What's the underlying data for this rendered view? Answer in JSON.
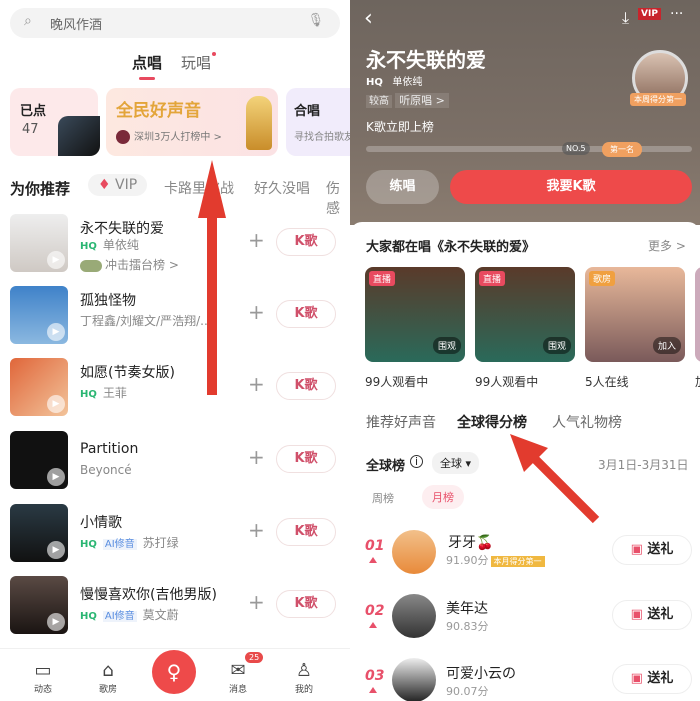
{
  "left": {
    "search": {
      "placeholder": "晚风作酒",
      "icon": "microphone-icon"
    },
    "tabs": [
      {
        "label": "点唱",
        "active": true
      },
      {
        "label": "玩唱",
        "dot": true
      }
    ],
    "cards": {
      "sung": {
        "label": "已点",
        "count": "47"
      },
      "promo": {
        "title": "全民好声音",
        "sub": "深圳3万人打榜中 >"
      },
      "chorus": {
        "title": "合唱",
        "sub": "寻找合拍歌友"
      }
    },
    "categories": [
      "为你推荐",
      "VIP",
      "卡路里挑战",
      "好久没唱",
      "伤感"
    ],
    "songs": [
      {
        "title": "永不失联的爱",
        "hq": "HQ",
        "artist": "单依纯",
        "extra": "冲击擂台榜 >"
      },
      {
        "title": "孤独怪物",
        "artist": "丁程鑫/刘耀文/严浩翔/..."
      },
      {
        "title": "如愿(节奏女版)",
        "hq": "HQ",
        "artist": "王菲"
      },
      {
        "title": "Partition",
        "artist": "Beyoncé"
      },
      {
        "title": "小情歌",
        "hq": "HQ",
        "ai": "AI修音",
        "artist": "苏打绿"
      },
      {
        "title": "慢慢喜欢你(吉他男版)",
        "hq": "HQ",
        "ai": "AI修音",
        "artist": "莫文蔚"
      }
    ],
    "k_label": "K歌",
    "nav": [
      {
        "label": "动态",
        "icon": "chat-icon"
      },
      {
        "label": "歌房",
        "icon": "house-icon"
      },
      {
        "label": "",
        "icon": "microphone-icon"
      },
      {
        "label": "消息",
        "icon": "mail-icon",
        "badge": "25"
      },
      {
        "label": "我的",
        "icon": "user-icon"
      }
    ]
  },
  "right": {
    "header": {
      "vip": "VIP",
      "title": "永不失联的爱",
      "hq": "HQ",
      "artist": "单依纯",
      "level": "较高",
      "original": "听原唱 >",
      "cta": "K歌立即上榜",
      "rank_no": "NO.5",
      "rank_first": "第一名",
      "avatar_badge": "本周得分第一"
    },
    "buttons": {
      "practice": "练唱",
      "sing": "我要K歌"
    },
    "section": {
      "title": "大家都在唱《永不失联的爱》",
      "more": "更多 >"
    },
    "rooms": [
      {
        "tag": "直播",
        "action": "围观",
        "caption": "99人观看中"
      },
      {
        "tag": "直播",
        "action": "围观",
        "caption": "99人观看中"
      },
      {
        "tag": "歌房",
        "action": "加入",
        "caption": "5人在线"
      },
      {
        "caption": "加"
      }
    ],
    "tabs": [
      {
        "label": "推荐好声音"
      },
      {
        "label": "全球得分榜",
        "active": true
      },
      {
        "label": "人气礼物榜"
      }
    ],
    "board": {
      "title": "全球榜",
      "filter": "全球 ▾",
      "range": "3月1日-3月31日",
      "periods": [
        {
          "label": "周榜"
        },
        {
          "label": "月榜",
          "active": true
        }
      ]
    },
    "ranking": [
      {
        "rank": "01",
        "name": "牙牙🍒",
        "score": "91.90分",
        "badge": "本月得分第一"
      },
      {
        "rank": "02",
        "name": "美年达",
        "score": "90.83分"
      },
      {
        "rank": "03",
        "name": "可爱小云の",
        "score": "90.07分"
      }
    ],
    "gift_label": "送礼",
    "accent": "#e84a5f"
  }
}
